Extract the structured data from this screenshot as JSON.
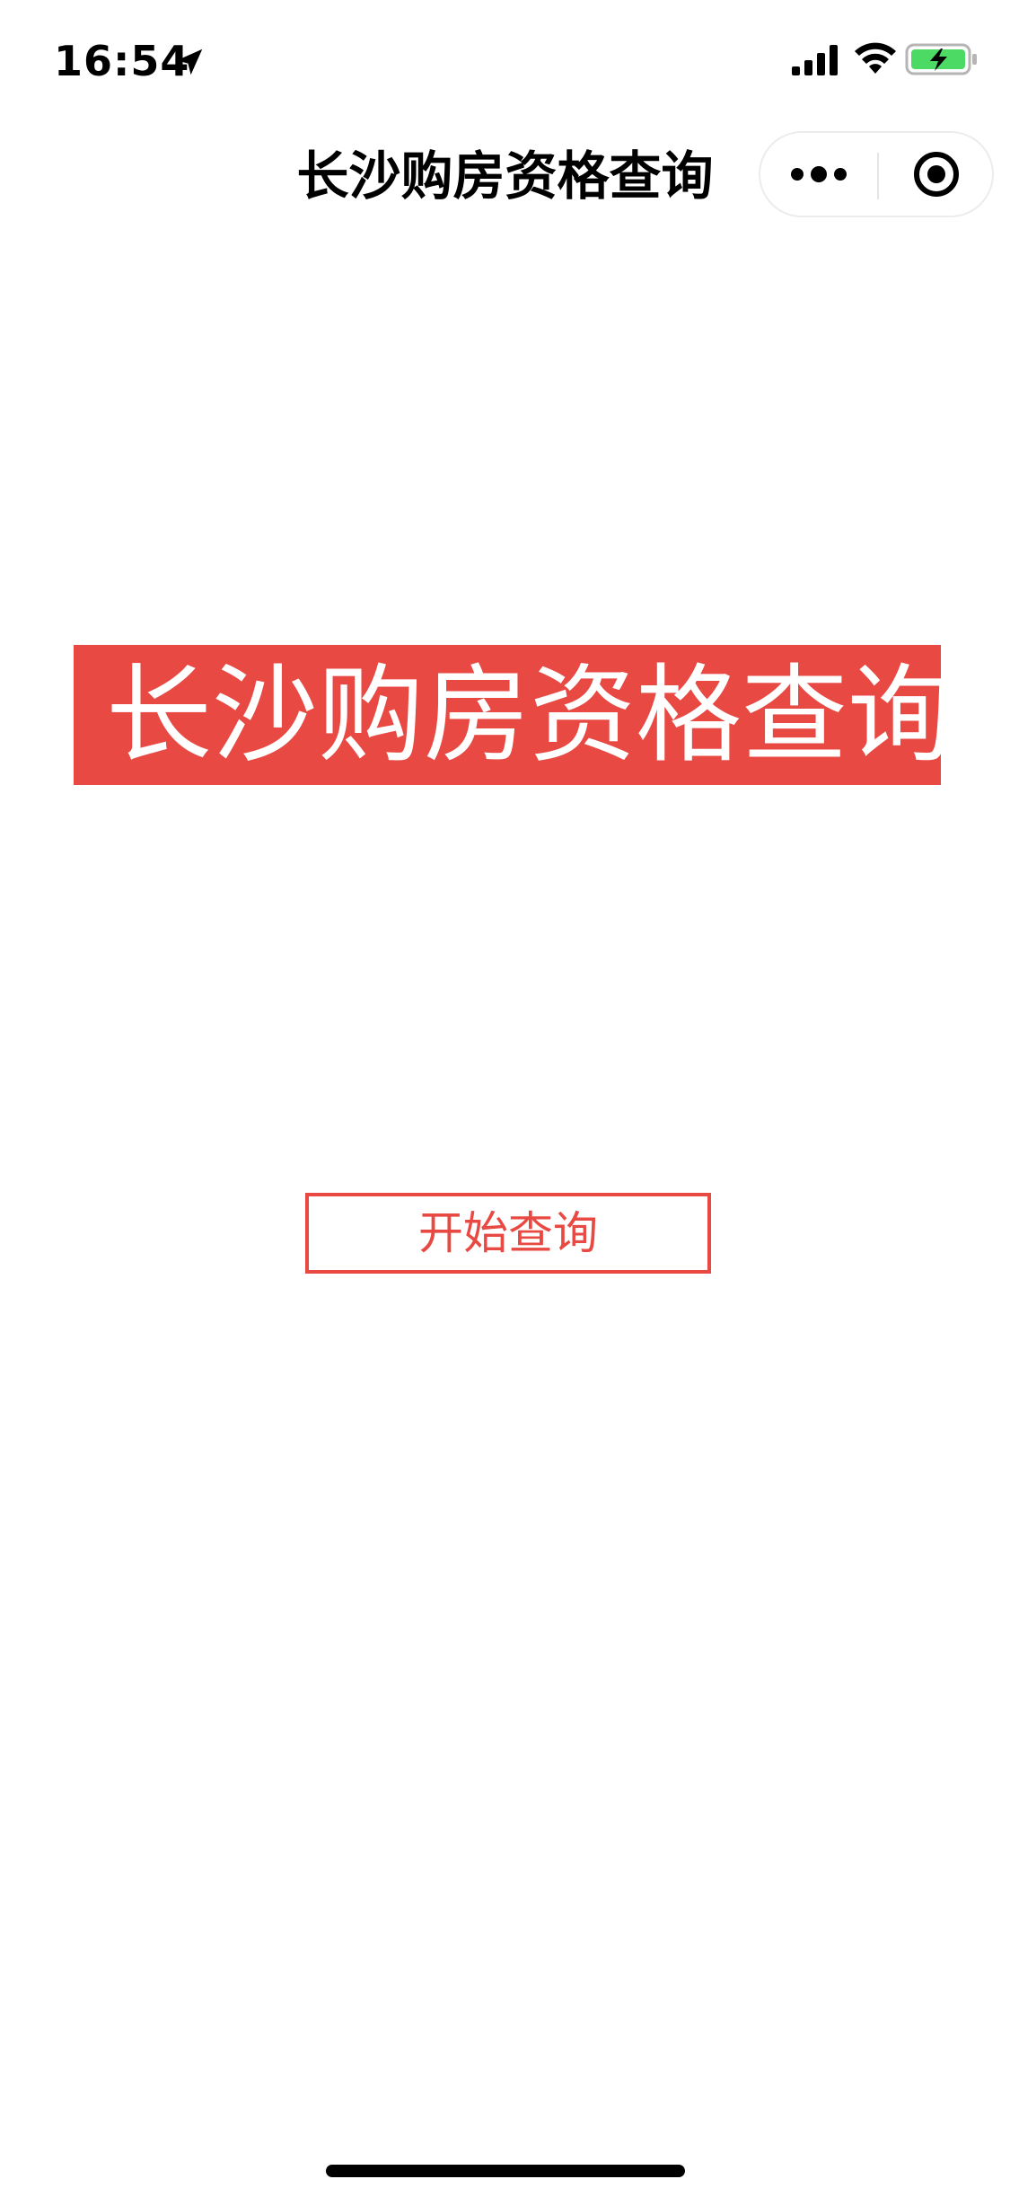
{
  "status_bar": {
    "time": "16:54",
    "icons": [
      "location-arrow-icon",
      "cellular-signal-icon",
      "wifi-icon",
      "battery-charging-icon"
    ],
    "battery_color": "#4cd964"
  },
  "nav_bar": {
    "title": "长沙购房资格查询",
    "capsule_icons": [
      "more-dots-icon",
      "close-target-icon"
    ]
  },
  "main": {
    "banner_title": "长沙购房资格查询",
    "start_button_label": "开始查询"
  },
  "colors": {
    "accent": "#e84a43",
    "background": "#ffffff",
    "text": "#000000"
  }
}
